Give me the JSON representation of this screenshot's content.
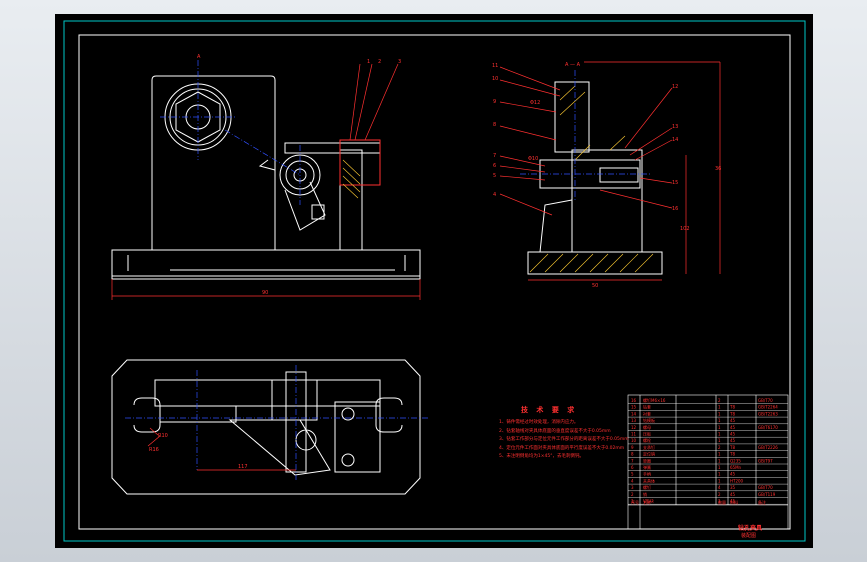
{
  "app": {
    "name": "CAD drawing viewer",
    "background_color": "#d3d8dd",
    "canvas_color": "#000000",
    "frame_color": "#00c8c8",
    "line_color_main": "#ffffff",
    "line_color_annotation": "#ff3030",
    "line_color_center": "#3050ff",
    "line_color_hidden": "#00e0e0"
  },
  "drawing": {
    "view_labels": {
      "section_a": "A — A",
      "front_A": "A",
      "dim_width_front": "90",
      "dim_width_side": "50",
      "dim_bottom_len": "117",
      "dim_r10": "R10",
      "dim_r16": "R16",
      "dim_side_height_1": "36",
      "dim_side_height_2": "102",
      "dim_phi_1": "Φ12",
      "dim_phi_2": "Φ10"
    },
    "balloons_front": [
      "1",
      "2",
      "3"
    ],
    "balloons_side_left": [
      "11",
      "10",
      "9",
      "8",
      "7",
      "6",
      "5",
      "4"
    ],
    "balloons_side_right": [
      "12",
      "13",
      "14",
      "15",
      "16"
    ]
  },
  "tech_requirements": {
    "title": "技 术 要 求",
    "notes": [
      "1、铸件需经过时效处理，消除内应力。",
      "2、钻套轴线对夹具体底面的垂直度误差不大于0.05mm",
      "3、钻套工作部分与定位元件工作部分的距离误差不大于0.05mm",
      "4、定位元件工作面对夹具体底面的平行度误差不大于0.02mm",
      "5、未注明倒角均为1×45°，去毛刺倒钝。"
    ]
  },
  "title_block": {
    "name": "钻孔夹具",
    "sub": "装配图",
    "rows": [
      [
        "16",
        "螺钉M6×16",
        "2",
        "",
        "GB/T70"
      ],
      [
        "15",
        "钻套",
        "1",
        "T8",
        "GB/T2264"
      ],
      [
        "14",
        "衬套",
        "1",
        "T8",
        "GB/T2263"
      ],
      [
        "13",
        "钻模板",
        "1",
        "45",
        ""
      ],
      [
        "12",
        "螺母",
        "1",
        "45",
        "GB/T6170"
      ],
      [
        "11",
        "压板",
        "1",
        "45",
        ""
      ],
      [
        "10",
        "螺栓",
        "1",
        "45",
        ""
      ],
      [
        "9",
        "支承钉",
        "2",
        "T8",
        "GB/T2226"
      ],
      [
        "8",
        "定位销",
        "1",
        "T8",
        ""
      ],
      [
        "7",
        "垫圈",
        "1",
        "Q235",
        "GB/T97"
      ],
      [
        "6",
        "弹簧",
        "1",
        "65Mn",
        ""
      ],
      [
        "5",
        "手柄",
        "1",
        "45",
        ""
      ],
      [
        "4",
        "夹具体",
        "1",
        "HT200",
        ""
      ],
      [
        "3",
        "螺钉",
        "4",
        "35",
        "GB/T70"
      ],
      [
        "2",
        "销",
        "2",
        "45",
        "GB/T119"
      ],
      [
        "1",
        "V形块",
        "1",
        "45",
        ""
      ]
    ],
    "header": [
      "序号",
      "名称",
      "数量",
      "材料",
      "备注"
    ]
  }
}
